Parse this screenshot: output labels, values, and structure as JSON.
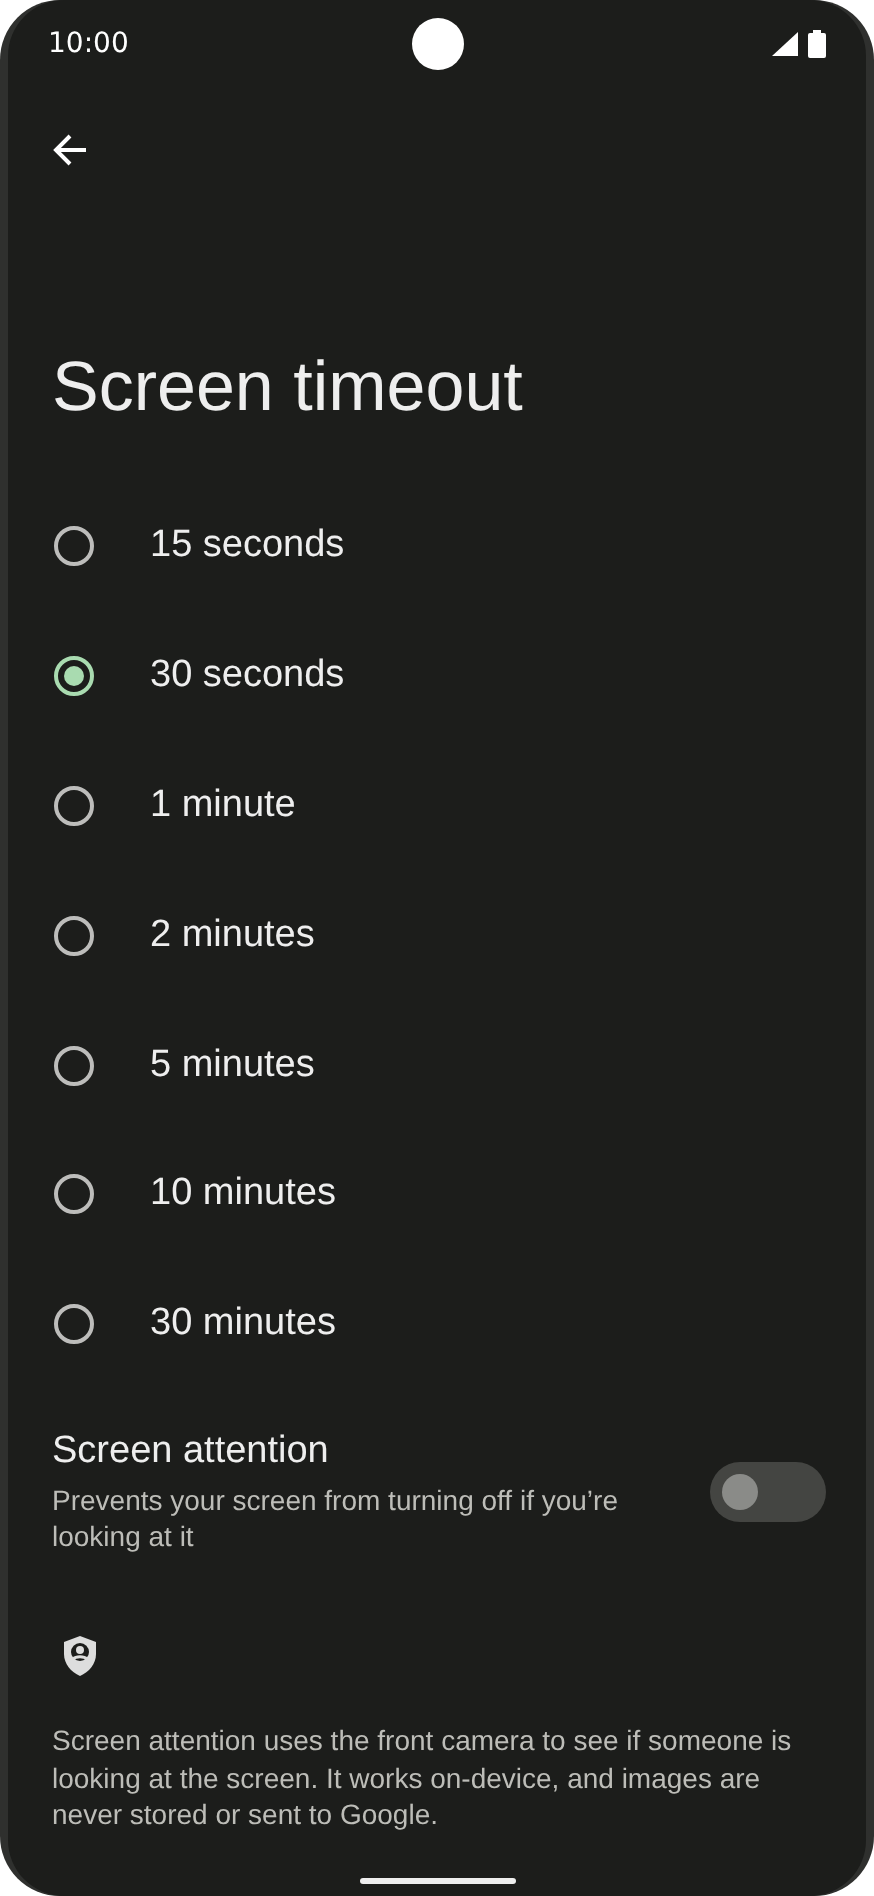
{
  "status_bar": {
    "time": "10:00"
  },
  "title": "Screen timeout",
  "options": [
    {
      "label": "15 seconds",
      "selected": false
    },
    {
      "label": "30 seconds",
      "selected": true
    },
    {
      "label": "1 minute",
      "selected": false
    },
    {
      "label": "2 minutes",
      "selected": false
    },
    {
      "label": "5 minutes",
      "selected": false
    },
    {
      "label": "10 minutes",
      "selected": false
    },
    {
      "label": "30 minutes",
      "selected": false
    }
  ],
  "attention": {
    "title": "Screen attention",
    "summary": "Prevents your screen from turning off if you’re looking at it",
    "on": false
  },
  "footer": "Screen attention uses the front camera to see if someone is looking at the screen. It works on-device, and images are never stored or sent to Google."
}
